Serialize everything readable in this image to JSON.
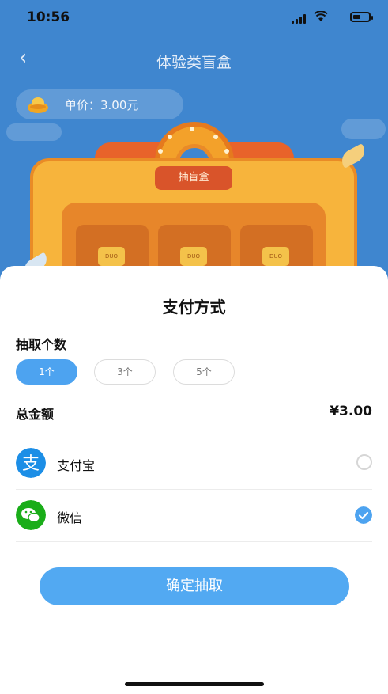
{
  "status_bar": {
    "time": "10:56"
  },
  "nav": {
    "title": "体验类盲盒",
    "back_icon": "chevron-left-icon"
  },
  "price": {
    "label": "单价：3.00元"
  },
  "machine": {
    "label": "抽盲盒",
    "slot_tag": "DUO"
  },
  "sheet": {
    "title": "支付方式",
    "quantity_label": "抽取个数",
    "quantities": [
      {
        "label": "1个",
        "selected": true
      },
      {
        "label": "3个",
        "selected": false
      },
      {
        "label": "5个",
        "selected": false
      }
    ],
    "total_label": "总金额",
    "total_value": "¥3.00",
    "payments": [
      {
        "name": "支付宝",
        "icon": "alipay-icon",
        "color": "#1c8ee6",
        "selected": false
      },
      {
        "name": "微信",
        "icon": "wechat-icon",
        "color": "#1aad19",
        "selected": true
      }
    ],
    "confirm_label": "确定抽取"
  },
  "colors": {
    "accent": "#4da3f0",
    "background": "#3f86cf"
  }
}
